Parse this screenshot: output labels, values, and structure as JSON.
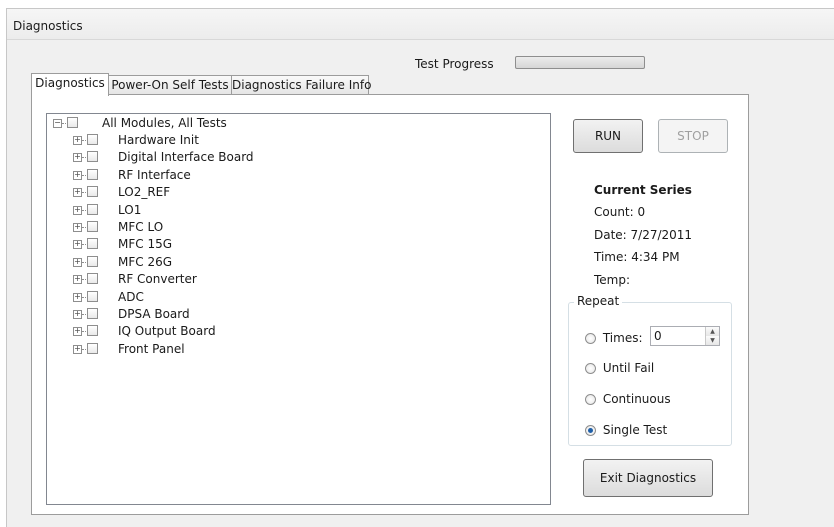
{
  "window": {
    "title": "Diagnostics"
  },
  "progress": {
    "label": "Test Progress",
    "value": 0
  },
  "tabs": [
    {
      "label": "Diagnostics"
    },
    {
      "label": "Power-On Self Tests"
    },
    {
      "label": "Diagnostics Failure Info"
    }
  ],
  "tree": {
    "root": "All Modules, All Tests",
    "items": [
      "Hardware Init",
      "Digital Interface Board",
      "RF Interface",
      "LO2_REF",
      "LO1",
      "MFC LO",
      "MFC 15G",
      "MFC 26G",
      "RF Converter",
      "ADC",
      "DPSA Board",
      "IQ Output Board",
      "Front Panel"
    ]
  },
  "buttons": {
    "run": "RUN",
    "stop": "STOP",
    "exit": "Exit Diagnostics"
  },
  "series": {
    "heading": "Current Series",
    "count": "Count: 0",
    "date": "Date:  7/27/2011",
    "time": "Time:  4:34 PM",
    "temp": "Temp:"
  },
  "repeat": {
    "title": "Repeat",
    "times_label": "Times:",
    "times_value": "0",
    "until_fail": "Until Fail",
    "continuous": "Continuous",
    "single_test": "Single Test",
    "selected": "single_test"
  }
}
